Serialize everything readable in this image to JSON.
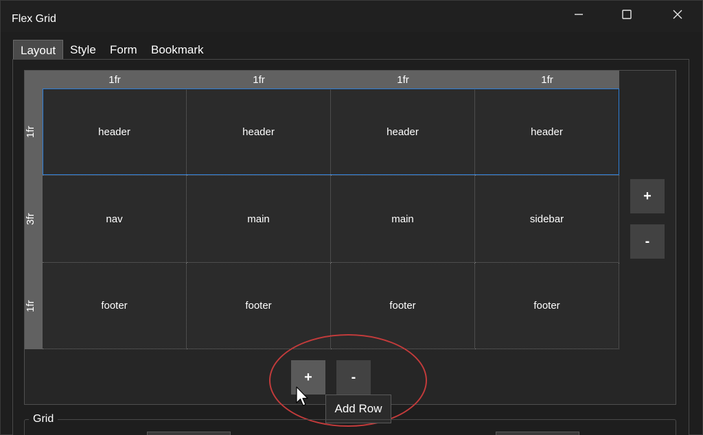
{
  "window": {
    "title": "Flex Grid"
  },
  "tabs": [
    {
      "label": "Layout",
      "active": true
    },
    {
      "label": "Style",
      "active": false
    },
    {
      "label": "Form",
      "active": false
    },
    {
      "label": "Bookmark",
      "active": false
    }
  ],
  "grid": {
    "columns": [
      "1fr",
      "1fr",
      "1fr",
      "1fr"
    ],
    "rows": [
      {
        "size": "1fr",
        "cells": [
          "header",
          "header",
          "header",
          "header"
        ]
      },
      {
        "size": "3fr",
        "cells": [
          "nav",
          "main",
          "main",
          "sidebar"
        ]
      },
      {
        "size": "1fr",
        "cells": [
          "footer",
          "footer",
          "footer",
          "footer"
        ]
      }
    ]
  },
  "buttons": {
    "add_column": "+",
    "remove_column": "-",
    "add_row": "+",
    "remove_row": "-"
  },
  "tooltip": {
    "text": "Add Row"
  },
  "grid_settings": {
    "legend": "Grid"
  },
  "colors": {
    "selection": "#2f7fd8",
    "annotation": "#c23b3b",
    "header_bar": "#616161"
  }
}
